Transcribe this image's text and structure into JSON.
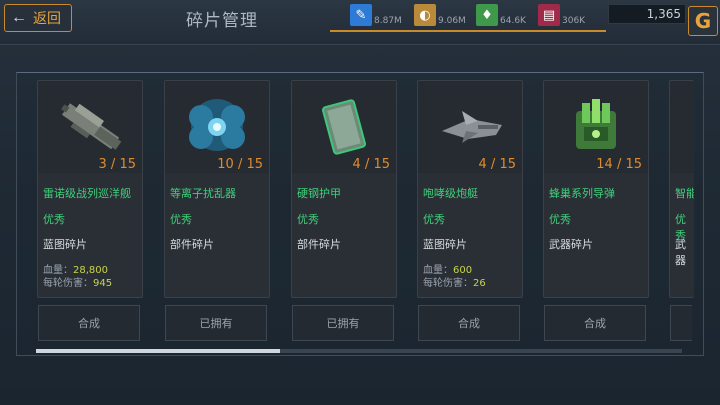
{
  "header": {
    "back_label": "返回",
    "title": "碎片管理"
  },
  "resources": [
    {
      "icon": "blueprint-icon",
      "color": "#2d7bd6",
      "value": "8.87M"
    },
    {
      "icon": "mineral-icon",
      "color": "#b88a3a",
      "value": "9.06M"
    },
    {
      "icon": "crystal-icon",
      "color": "#3e9a4a",
      "value": "64.6K"
    },
    {
      "icon": "gem-icon",
      "color": "#a02a4a",
      "value": "306K"
    }
  ],
  "coins": "1,365",
  "cards": [
    {
      "name": "雷诺级战列巡洋舰",
      "count": "3 / 15",
      "quality": "优秀",
      "kind": "蓝图碎片",
      "stat1_label": "血量：",
      "stat1_value": "28,800",
      "stat2_label": "每轮伤害：",
      "stat2_value": "945",
      "action": "合成"
    },
    {
      "name": "等离子扰乱器",
      "count": "10 / 15",
      "quality": "优秀",
      "kind": "部件碎片",
      "action": "已拥有"
    },
    {
      "name": "硬钢护甲",
      "count": "4 / 15",
      "quality": "优秀",
      "kind": "部件碎片",
      "action": "已拥有"
    },
    {
      "name": "咆哮级炮艇",
      "count": "4 / 15",
      "quality": "优秀",
      "kind": "蓝图碎片",
      "stat1_label": "血量：",
      "stat1_value": "600",
      "stat2_label": "每轮伤害：",
      "stat2_value": "26",
      "action": "合成"
    },
    {
      "name": "蜂巢系列导弹",
      "count": "14 / 15",
      "quality": "优秀",
      "kind": "武器碎片",
      "action": "合成"
    },
    {
      "name": "智能",
      "quality": "优秀",
      "kind": "武器"
    }
  ]
}
